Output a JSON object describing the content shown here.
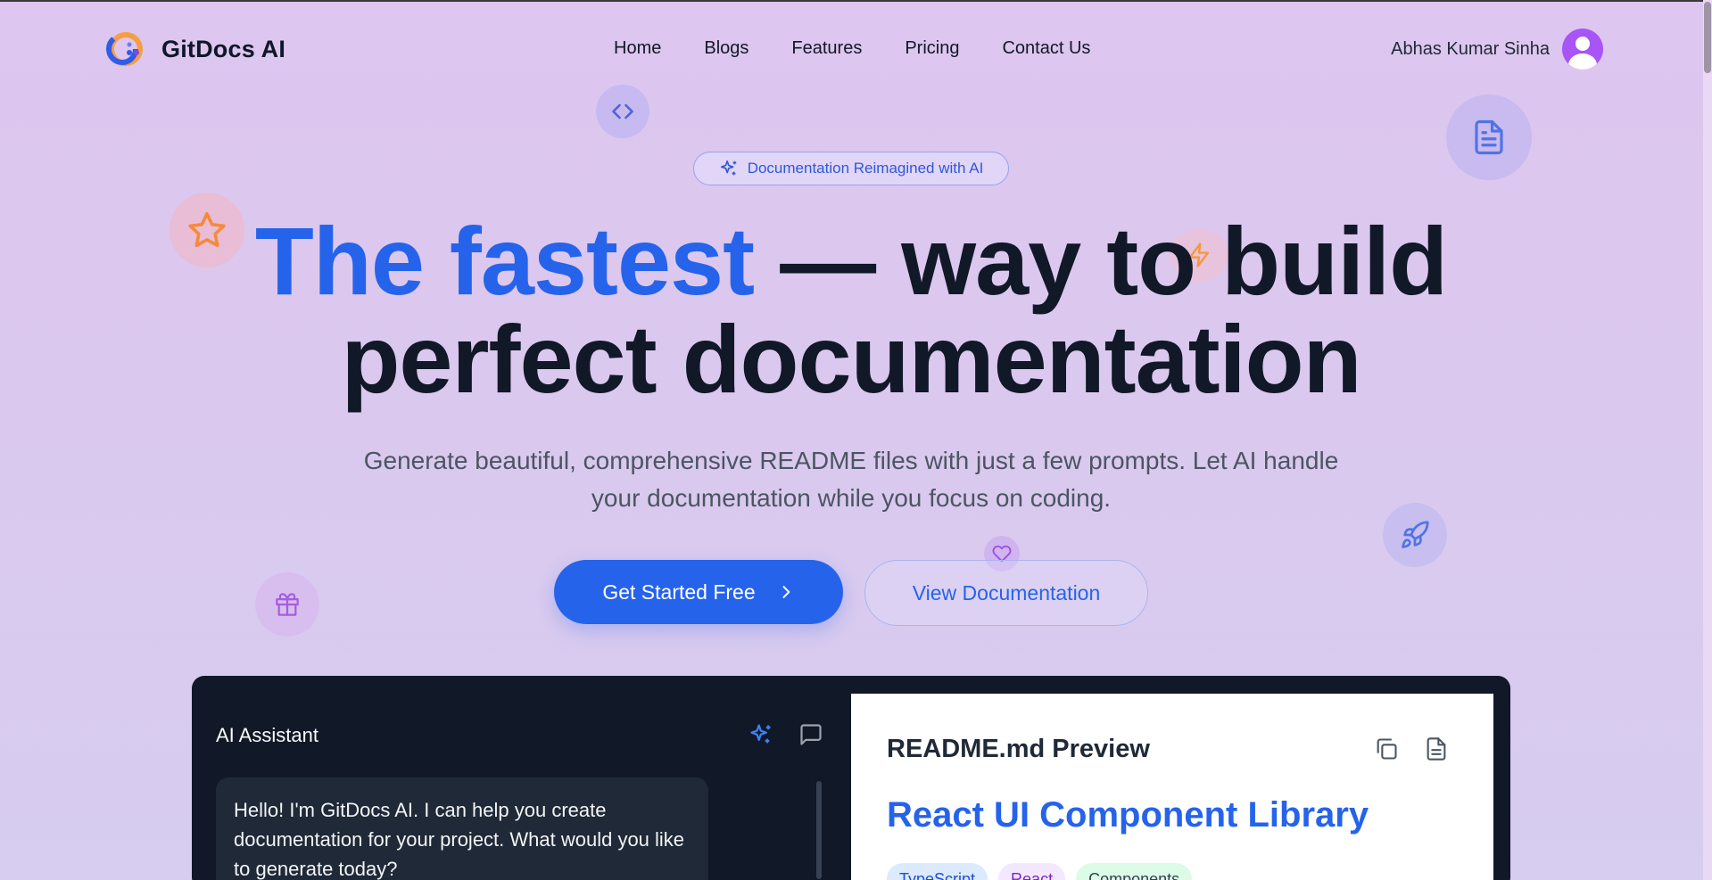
{
  "brand": {
    "name": "GitDocs AI"
  },
  "nav": {
    "links": [
      "Home",
      "Blogs",
      "Features",
      "Pricing",
      "Contact Us"
    ]
  },
  "user": {
    "name": "Abhas Kumar Sinha"
  },
  "hero": {
    "badge": "Documentation Reimagined with AI",
    "title_accent": "The fastest",
    "title_rest_line1": " — way to build",
    "title_line2": "perfect documentation",
    "subtitle": "Generate beautiful, comprehensive README files with just a few prompts. Let AI handle your documentation while you focus on coding.",
    "cta_primary": "Get Started Free",
    "cta_secondary": "View Documentation"
  },
  "demo": {
    "chat_title": "AI Assistant",
    "assistant_message": "Hello! I'm GitDocs AI. I can help you create documentation for your project. What would you like to generate today?",
    "preview_title": "README.md Preview",
    "readme_heading": "React UI Component Library",
    "tags": [
      "TypeScript",
      "React",
      "Components"
    ]
  },
  "colors": {
    "accent": "#2563eb",
    "dark_panel": "#111827",
    "avatar": "#a855f7"
  },
  "icons": [
    "code-icon",
    "file-text-icon",
    "star-icon",
    "zap-icon",
    "sparkles-icon",
    "rocket-icon",
    "heart-icon",
    "gift-icon",
    "chevron-right-icon",
    "message-square-icon",
    "copy-icon"
  ]
}
